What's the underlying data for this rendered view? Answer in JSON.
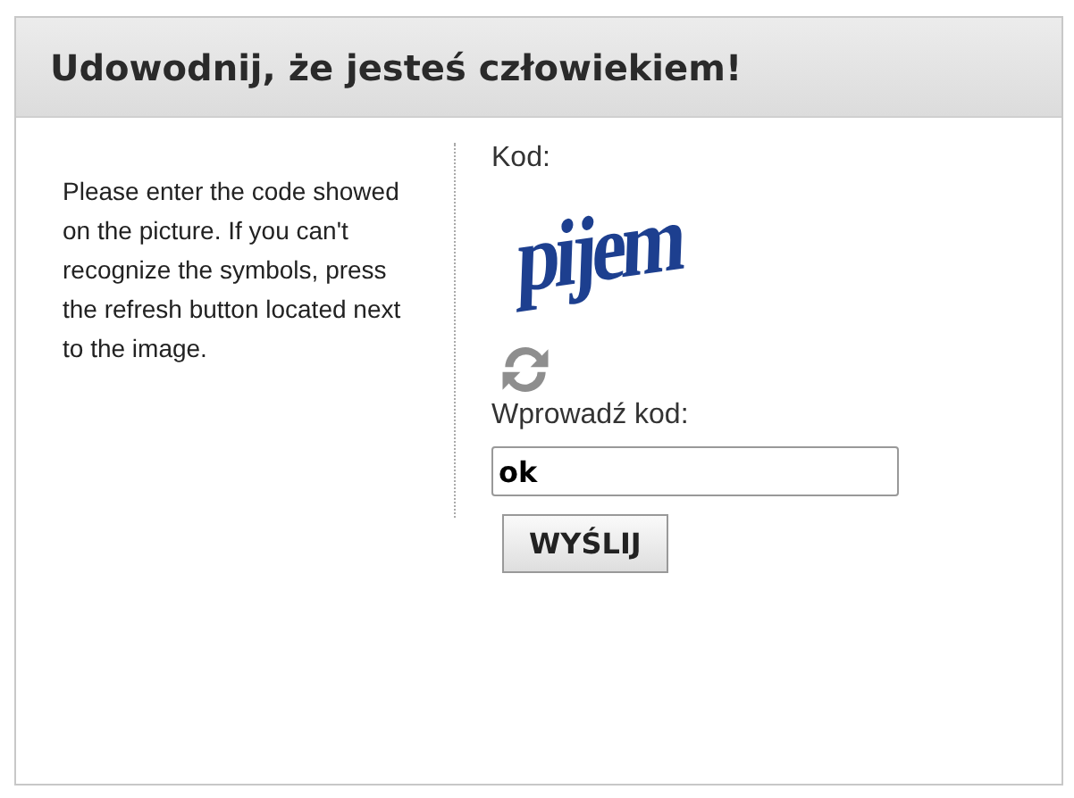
{
  "title": "Udowodnij, że jesteś człowiekiem!",
  "instructions": "Please enter the code showed on the picture. If you can't recognize the symbols, press the refresh button located next to the image.",
  "code_label": "Kod:",
  "captcha": "pijem",
  "input_label": "Wprowadź kod:",
  "input": {
    "value": "ok"
  },
  "submit": "WYŚLIJ"
}
